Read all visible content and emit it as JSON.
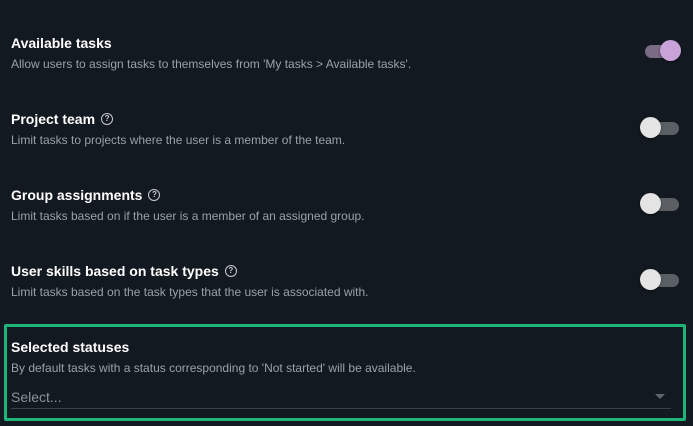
{
  "settings": [
    {
      "title": "Available tasks",
      "description": "Allow users to assign tasks to themselves from 'My tasks > Available tasks'.",
      "enabled": true,
      "help": false
    },
    {
      "title": "Project team",
      "description": "Limit tasks to projects where the user is a member of the team.",
      "enabled": false,
      "help": true
    },
    {
      "title": "Group assignments",
      "description": "Limit tasks based on if the user is a member of an assigned group.",
      "enabled": false,
      "help": true
    },
    {
      "title": "User skills based on task types",
      "description": "Limit tasks based on the task types that the user is associated with.",
      "enabled": false,
      "help": true
    }
  ],
  "help_glyph": "?",
  "selected_statuses": {
    "title": "Selected statuses",
    "description": "By default tasks with a status corresponding to 'Not started' will be available.",
    "placeholder": "Select..."
  },
  "colors": {
    "background": "#131920",
    "toggle_on": "#c9a2d8",
    "highlight": "#1db57a"
  },
  "icons": {
    "help": "help-circle-icon",
    "dropdown": "chevron-down-icon"
  }
}
